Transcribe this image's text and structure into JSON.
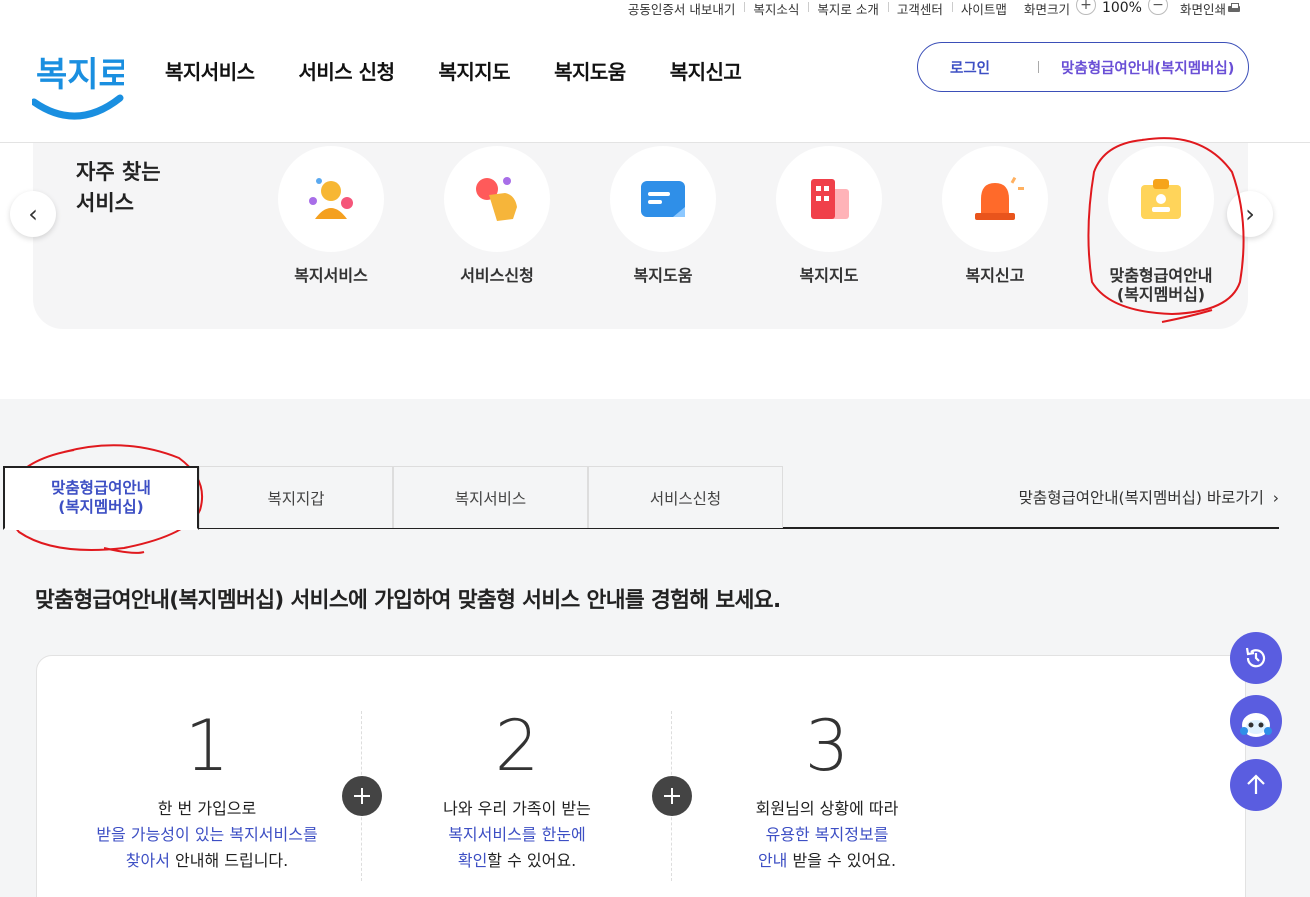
{
  "utility": {
    "links": [
      "공동인증서 내보내기",
      "복지소식",
      "복지로 소개",
      "고객센터",
      "사이트맵"
    ],
    "zoom_label": "화면크기",
    "zoom_in": "+",
    "zoom_value": "100%",
    "zoom_out": "−",
    "print_label": "화면인쇄"
  },
  "header": {
    "logo_text": "복지로",
    "gnb": [
      "복지서비스",
      "서비스 신청",
      "복지지도",
      "복지도움",
      "복지신고"
    ],
    "login": "로그인",
    "membership": "맞춤형급여안내(복지멤버십)"
  },
  "quick": {
    "title_line1": "자주 찾는",
    "title_line2": "서비스",
    "items": [
      {
        "label": "복지서비스",
        "icon": "people-icon"
      },
      {
        "label": "서비스신청",
        "icon": "hand-touch-icon"
      },
      {
        "label": "복지도움",
        "icon": "chat-bubble-icon"
      },
      {
        "label": "복지지도",
        "icon": "map-building-icon"
      },
      {
        "label": "복지신고",
        "icon": "siren-icon"
      },
      {
        "label_line1": "맞춤형급여안내",
        "label_line2": "(복지멤버십)",
        "icon": "member-card-icon"
      }
    ],
    "prev": "‹",
    "next": "›"
  },
  "tabs": {
    "items": [
      {
        "line1": "맞춤형급여안내",
        "line2": "(복지멤버십)"
      },
      {
        "label": "복지지갑"
      },
      {
        "label": "복지서비스"
      },
      {
        "label": "서비스신청"
      }
    ],
    "shortcut": "맞춤형급여안내(복지멤버십) 바로가기"
  },
  "content": {
    "description": "맞춤형급여안내(복지멤버십) 서비스에 가입하여 맞춤형 서비스 안내를 경험해 보세요.",
    "steps": [
      {
        "num": "1",
        "line1": "한 번 가입으로",
        "line2": "받을 가능성이 있는 복지서비스를",
        "line3_hl": "찾아서",
        "line3_rest": " 안내해 드립니다."
      },
      {
        "num": "2",
        "line1": "나와 우리 가족이 받는",
        "line2": "복지서비스를 한눈에",
        "line3_hl": "확인",
        "line3_rest": "할 수 있어요."
      },
      {
        "num": "3",
        "line1": "회원님의 상황에 따라",
        "line2": "유용한 복지정보를",
        "line3_hl": "안내",
        "line3_rest": " 받을 수 있어요."
      }
    ]
  },
  "colors": {
    "accent": "#3d4fc4",
    "member": "#6a4fd6",
    "float": "#5a5de0",
    "annotation": "#e0191e"
  }
}
